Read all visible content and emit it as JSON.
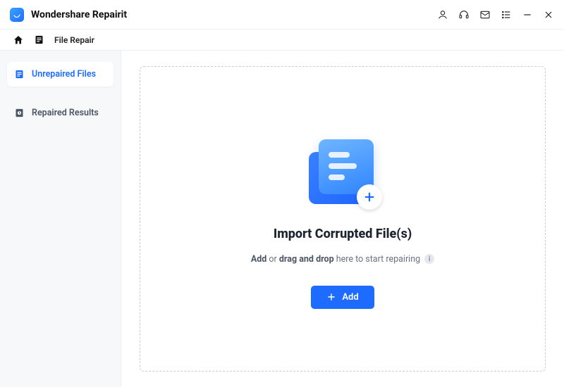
{
  "app": {
    "title": "Wondershare Repairit"
  },
  "titlebar_icons": {
    "account": "account-icon",
    "headset": "headset-icon",
    "mail": "mail-icon",
    "list": "list-icon",
    "minimize": "minimize-icon",
    "close": "close-icon"
  },
  "nav": {
    "section_label": "File Repair"
  },
  "sidebar": {
    "items": [
      {
        "label": "Unrepaired Files",
        "active": true
      },
      {
        "label": "Repaired Results",
        "active": false
      }
    ]
  },
  "dropzone": {
    "headline": "Import Corrupted File(s)",
    "sub_before": "Add",
    "sub_or": " or ",
    "sub_dragdrop": "drag and drop",
    "sub_after": " here to start repairing",
    "add_button": "Add"
  }
}
